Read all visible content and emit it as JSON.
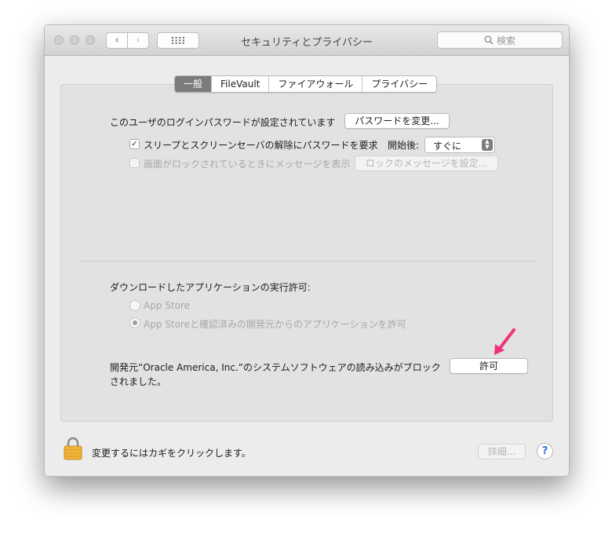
{
  "window": {
    "title": "セキュリティとプライバシー",
    "search_placeholder": "検索"
  },
  "tabs": [
    {
      "label": "一般"
    },
    {
      "label": "FileVault"
    },
    {
      "label": "ファイアウォール"
    },
    {
      "label": "プライバシー"
    }
  ],
  "general": {
    "password_label": "このユーザのログインパスワードが設定されています",
    "change_password_button": "パスワードを変更...",
    "require_password_label": "スリープとスクリーンセーバの解除にパスワードを要求",
    "start_label": "開始後:",
    "start_value": "すぐに",
    "lock_message_label": "画面がロックされているときにメッセージを表示",
    "lock_message_button": "ロックのメッセージを設定..."
  },
  "downloads": {
    "heading": "ダウンロードしたアプリケーションの実行許可:",
    "options": [
      {
        "label": "App Store"
      },
      {
        "label": "App Storeと確認済みの開発元からのアプリケーションを許可"
      }
    ],
    "blocked_line1": "開発元“Oracle America, Inc.”のシステムソフトウェアの読み込みがブロック",
    "blocked_line2": "されました。",
    "allow_button": "許可"
  },
  "footer": {
    "lock_text": "変更するにはカギをクリックします。",
    "advanced_button": "詳細...",
    "help_label": "?"
  },
  "colors": {
    "accent_arrow": "#f0337a",
    "lock_gold": "#f2b33a",
    "active_tab": "#7b7b7b"
  }
}
